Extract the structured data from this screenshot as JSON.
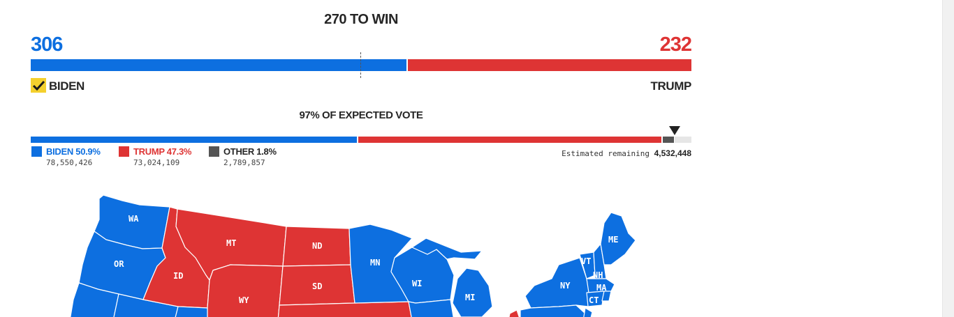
{
  "header": {
    "title": "270 TO WIN"
  },
  "electoral": {
    "biden_votes": "306",
    "trump_votes": "232",
    "biden_label": "BIDEN",
    "trump_label": "TRUMP",
    "biden_share": 0.5688,
    "winner": "BIDEN",
    "colors": {
      "dem": "#0d6fe0",
      "rep": "#de3434",
      "other": "#555555",
      "remaining": "#e6e6e6"
    }
  },
  "popular": {
    "expected_label": "97% OF EXPECTED VOTE",
    "biden": {
      "label": "BIDEN 50.9%",
      "votes": "78,550,426"
    },
    "trump": {
      "label": "TRUMP 47.3%",
      "votes": "73,024,109"
    },
    "other": {
      "label": "OTHER 1.8%",
      "votes": "2,789,857"
    },
    "remaining_label": "Estimated remaining",
    "remaining_votes": "4,532,448"
  },
  "map": {
    "states": [
      {
        "abbr": "WA",
        "party": "dem"
      },
      {
        "abbr": "OR",
        "party": "dem"
      },
      {
        "abbr": "ID",
        "party": "rep"
      },
      {
        "abbr": "MT",
        "party": "rep"
      },
      {
        "abbr": "WY",
        "party": "rep"
      },
      {
        "abbr": "ND",
        "party": "rep"
      },
      {
        "abbr": "SD",
        "party": "rep"
      },
      {
        "abbr": "MN",
        "party": "dem"
      },
      {
        "abbr": "WI",
        "party": "dem"
      },
      {
        "abbr": "MI",
        "party": "dem"
      },
      {
        "abbr": "NY",
        "party": "dem"
      },
      {
        "abbr": "ME",
        "party": "dem"
      },
      {
        "abbr": "VT",
        "party": "dem"
      },
      {
        "abbr": "NH",
        "party": "dem"
      },
      {
        "abbr": "MA",
        "party": "dem"
      },
      {
        "abbr": "CT",
        "party": "dem"
      }
    ]
  }
}
